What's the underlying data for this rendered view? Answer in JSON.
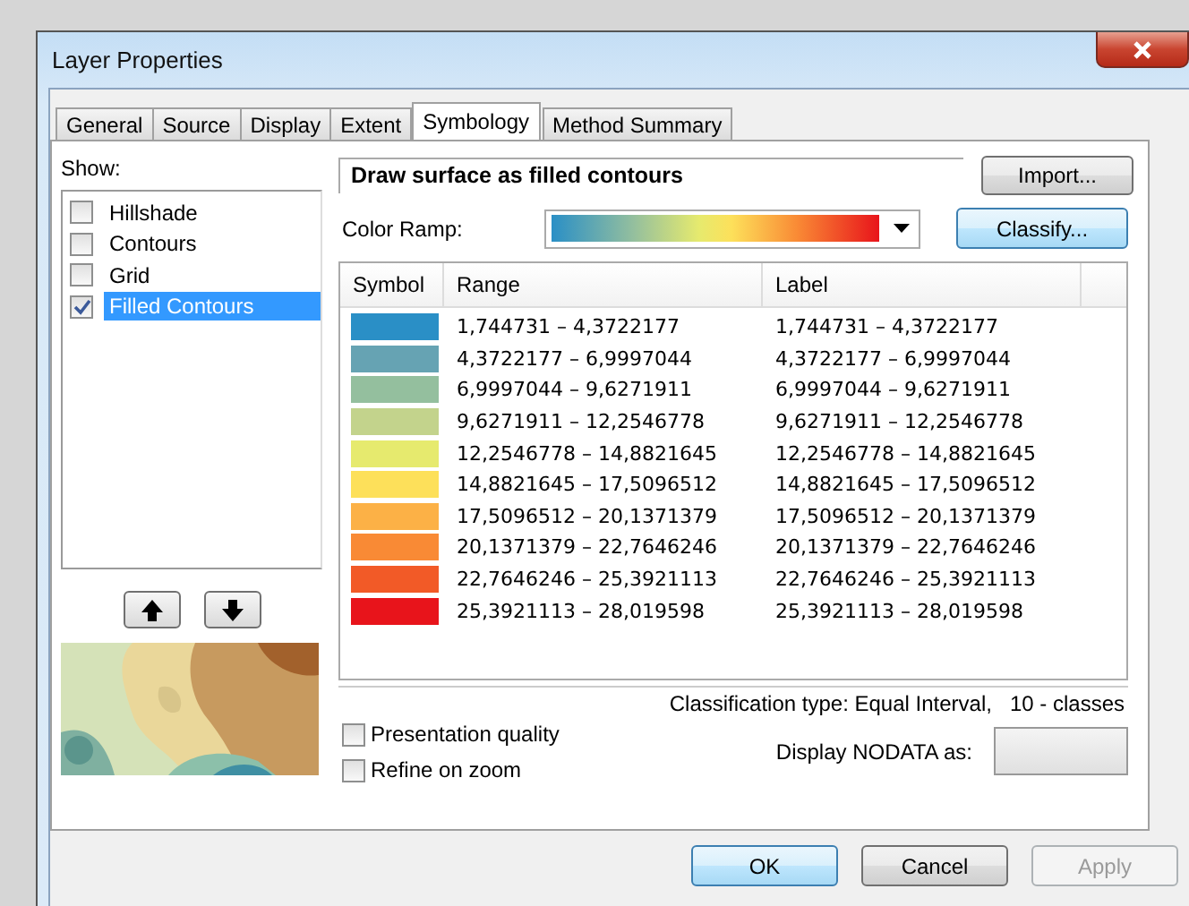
{
  "window": {
    "title": "Layer Properties"
  },
  "tabs": [
    {
      "label": "General",
      "selected": false
    },
    {
      "label": "Source",
      "selected": false
    },
    {
      "label": "Display",
      "selected": false
    },
    {
      "label": "Extent",
      "selected": false
    },
    {
      "label": "Symbology",
      "selected": true
    },
    {
      "label": "Method Summary",
      "selected": false
    }
  ],
  "show": {
    "label": "Show:",
    "items": [
      {
        "label": "Hillshade",
        "checked": false,
        "selected": false
      },
      {
        "label": "Contours",
        "checked": false,
        "selected": false
      },
      {
        "label": "Grid",
        "checked": false,
        "selected": false
      },
      {
        "label": "Filled Contours",
        "checked": true,
        "selected": true
      }
    ]
  },
  "description": "Draw surface as filled contours",
  "import_button": "Import...",
  "color_ramp": {
    "label": "Color Ramp:"
  },
  "classify_button": "Classify...",
  "table": {
    "columns": [
      "Symbol",
      "Range",
      "Label"
    ],
    "rows": [
      {
        "color": "#2a8fc6",
        "range": "1,744731 – 4,3722177",
        "label": "1,744731 – 4,3722177"
      },
      {
        "color": "#66a3b3",
        "range": "4,3722177 – 6,9997044",
        "label": "4,3722177 – 6,9997044"
      },
      {
        "color": "#94bf9e",
        "range": "6,9997044 – 9,6271911",
        "label": "6,9997044 – 9,6271911"
      },
      {
        "color": "#c3d38c",
        "range": "9,6271911 – 12,2546778",
        "label": "9,6271911 – 12,2546778"
      },
      {
        "color": "#e6ea6e",
        "range": "12,2546778 – 14,8821645",
        "label": "12,2546778 – 14,8821645"
      },
      {
        "color": "#fde05a",
        "range": "14,8821645 – 17,5096512",
        "label": "14,8821645 – 17,5096512"
      },
      {
        "color": "#fcb146",
        "range": "17,5096512 – 20,1371379",
        "label": "17,5096512 – 20,1371379"
      },
      {
        "color": "#f98a35",
        "range": "20,1371379 – 22,7646246",
        "label": "20,1371379 – 22,7646246"
      },
      {
        "color": "#f25a27",
        "range": "22,7646246 – 25,3921113",
        "label": "22,7646246 – 25,3921113"
      },
      {
        "color": "#e8141b",
        "range": "25,3921113 – 28,019598",
        "label": "25,3921113 – 28,019598"
      }
    ]
  },
  "classification": "Classification type: Equal Interval,   10 - classes",
  "options": [
    {
      "label": "Presentation quality",
      "checked": false
    },
    {
      "label": "Refine on zoom",
      "checked": false
    }
  ],
  "nodata_label": "Display NODATA as:",
  "buttons": [
    {
      "label": "OK",
      "disabled": false,
      "default": true
    },
    {
      "label": "Cancel",
      "disabled": false,
      "default": false
    },
    {
      "label": "Apply",
      "disabled": true,
      "default": false
    }
  ]
}
